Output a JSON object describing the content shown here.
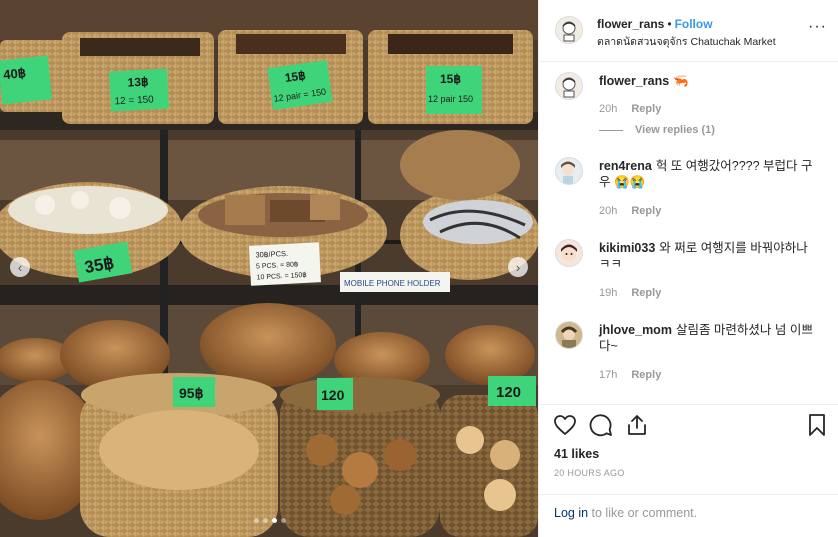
{
  "post": {
    "username": "flower_rans",
    "separator": "•",
    "follow_label": "Follow",
    "location": "ตลาดนัดสวนจตุจักร Chatuchak Market",
    "more_label": "···"
  },
  "photo": {
    "price_tags": [
      "40฿",
      "13฿",
      "12 = 150",
      "15฿",
      "12 pair = 150",
      "15฿",
      "12 pair 150",
      "35฿",
      "95฿",
      "120",
      "120"
    ],
    "sign_price": "30฿/PCS.",
    "sign_line2": "5 PCS. = 80฿",
    "sign_line3": "10 PCS. = 150฿",
    "sign_holder": "MOBILE PHONE HOLDER",
    "prev_arrow": "‹",
    "next_arrow": "›",
    "slide_count": 4,
    "active_slide": 3
  },
  "comments": [
    {
      "user": "flower_rans",
      "text": "🦐",
      "time": "20h",
      "reply_label": "Reply",
      "view_replies": "View replies (1)"
    },
    {
      "user": "ren4rena",
      "text": "헉 또 여행갔어???? 부럽다 구우 😭😭",
      "time": "20h",
      "reply_label": "Reply"
    },
    {
      "user": "kikimi033",
      "text": "와 쩌로 여행지를 바꿔야하나 ㅋㅋ",
      "time": "19h",
      "reply_label": "Reply"
    },
    {
      "user": "jhlove_mom",
      "text": "살림좀 마련하셨나 넘 이쁘다~",
      "time": "17h",
      "reply_label": "Reply"
    }
  ],
  "actions": {
    "likes": "41 likes",
    "time_ago": "20 HOURS AGO",
    "login_link": "Log in",
    "login_rest": " to like or comment."
  },
  "icons": {
    "like": "heart-icon",
    "comment": "comment-icon",
    "share": "share-icon",
    "save": "bookmark-icon"
  },
  "colors": {
    "accent": "#3897f0",
    "muted": "#999999",
    "border": "#efefef",
    "tag_green": "#3fd47a"
  }
}
